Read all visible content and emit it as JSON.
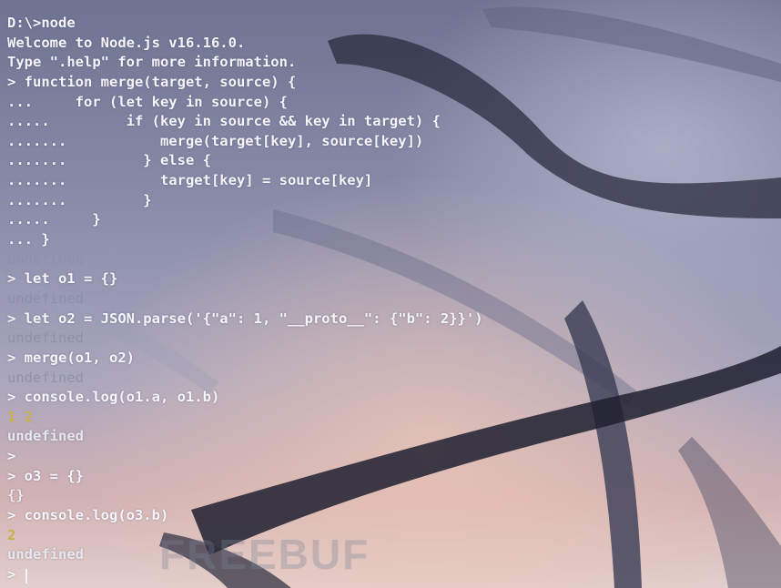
{
  "terminal": {
    "lines": [
      {
        "text": "D:\\>node",
        "kind": "input"
      },
      {
        "text": "Welcome to Node.js v16.16.0.",
        "kind": "output"
      },
      {
        "text": "Type \".help\" for more information.",
        "kind": "output"
      },
      {
        "text": "> function merge(target, source) {",
        "kind": "input"
      },
      {
        "text": "...     for (let key in source) {",
        "kind": "input"
      },
      {
        "text": ".....         if (key in source && key in target) {",
        "kind": "input"
      },
      {
        "text": ".......           merge(target[key], source[key])",
        "kind": "input"
      },
      {
        "text": ".......         } else {",
        "kind": "input"
      },
      {
        "text": ".......           target[key] = source[key]",
        "kind": "input"
      },
      {
        "text": ".......         }",
        "kind": "input"
      },
      {
        "text": ".....     }",
        "kind": "input"
      },
      {
        "text": "... }",
        "kind": "input"
      },
      {
        "text": "undefined",
        "kind": "muted"
      },
      {
        "text": "> let o1 = {}",
        "kind": "input"
      },
      {
        "text": "undefined",
        "kind": "muted"
      },
      {
        "text": "> let o2 = JSON.parse('{\"a\": 1, \"__proto__\": {\"b\": 2}}')",
        "kind": "input"
      },
      {
        "text": "undefined",
        "kind": "muted"
      },
      {
        "text": "> merge(o1, o2)",
        "kind": "input"
      },
      {
        "text": "undefined",
        "kind": "muted"
      },
      {
        "text": "> console.log(o1.a, o1.b)",
        "kind": "input"
      },
      {
        "text": "1 2",
        "kind": "number"
      },
      {
        "text": "undefined",
        "kind": "result"
      },
      {
        "text": ">",
        "kind": "input"
      },
      {
        "text": "> o3 = {}",
        "kind": "input"
      },
      {
        "text": "{}",
        "kind": "result"
      },
      {
        "text": "> console.log(o3.b)",
        "kind": "input"
      },
      {
        "text": "2",
        "kind": "number"
      },
      {
        "text": "undefined",
        "kind": "result"
      },
      {
        "text": ">",
        "kind": "input"
      }
    ]
  },
  "watermark": {
    "text": "FREEBUF"
  },
  "colors": {
    "text": "#f4f4fa",
    "muted": "#8b90a6",
    "number": "#c9b04a"
  }
}
